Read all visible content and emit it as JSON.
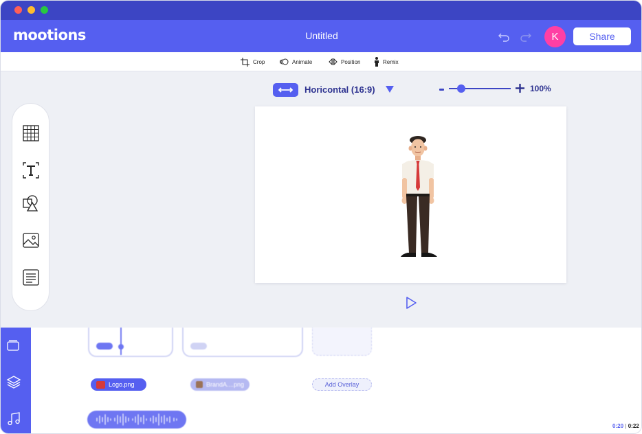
{
  "window": {
    "title_dots": [
      "#ff5f57",
      "#ffbd2e",
      "#28c840"
    ]
  },
  "header": {
    "logo": "mootions",
    "document_title": "Untitled",
    "avatar_initial": "K",
    "share_label": "Share"
  },
  "toolbar": {
    "crop": "Crop",
    "animate": "Animate",
    "position": "Position",
    "remix": "Remix"
  },
  "canvas_controls": {
    "aspect_ratio": "Horicontal (16:9)",
    "zoom_percent": "100%",
    "zoom_level": 0.15
  },
  "timeline": {
    "chips": {
      "logo": "Logo.png",
      "brand": "BrandA....png",
      "overlay": "Add Overlay"
    },
    "time_current": "0:20",
    "time_total": "0:22"
  },
  "colors": {
    "accent": "#555ff0",
    "accent_dark": "#3c45c4",
    "avatar": "#ff3fa4"
  }
}
